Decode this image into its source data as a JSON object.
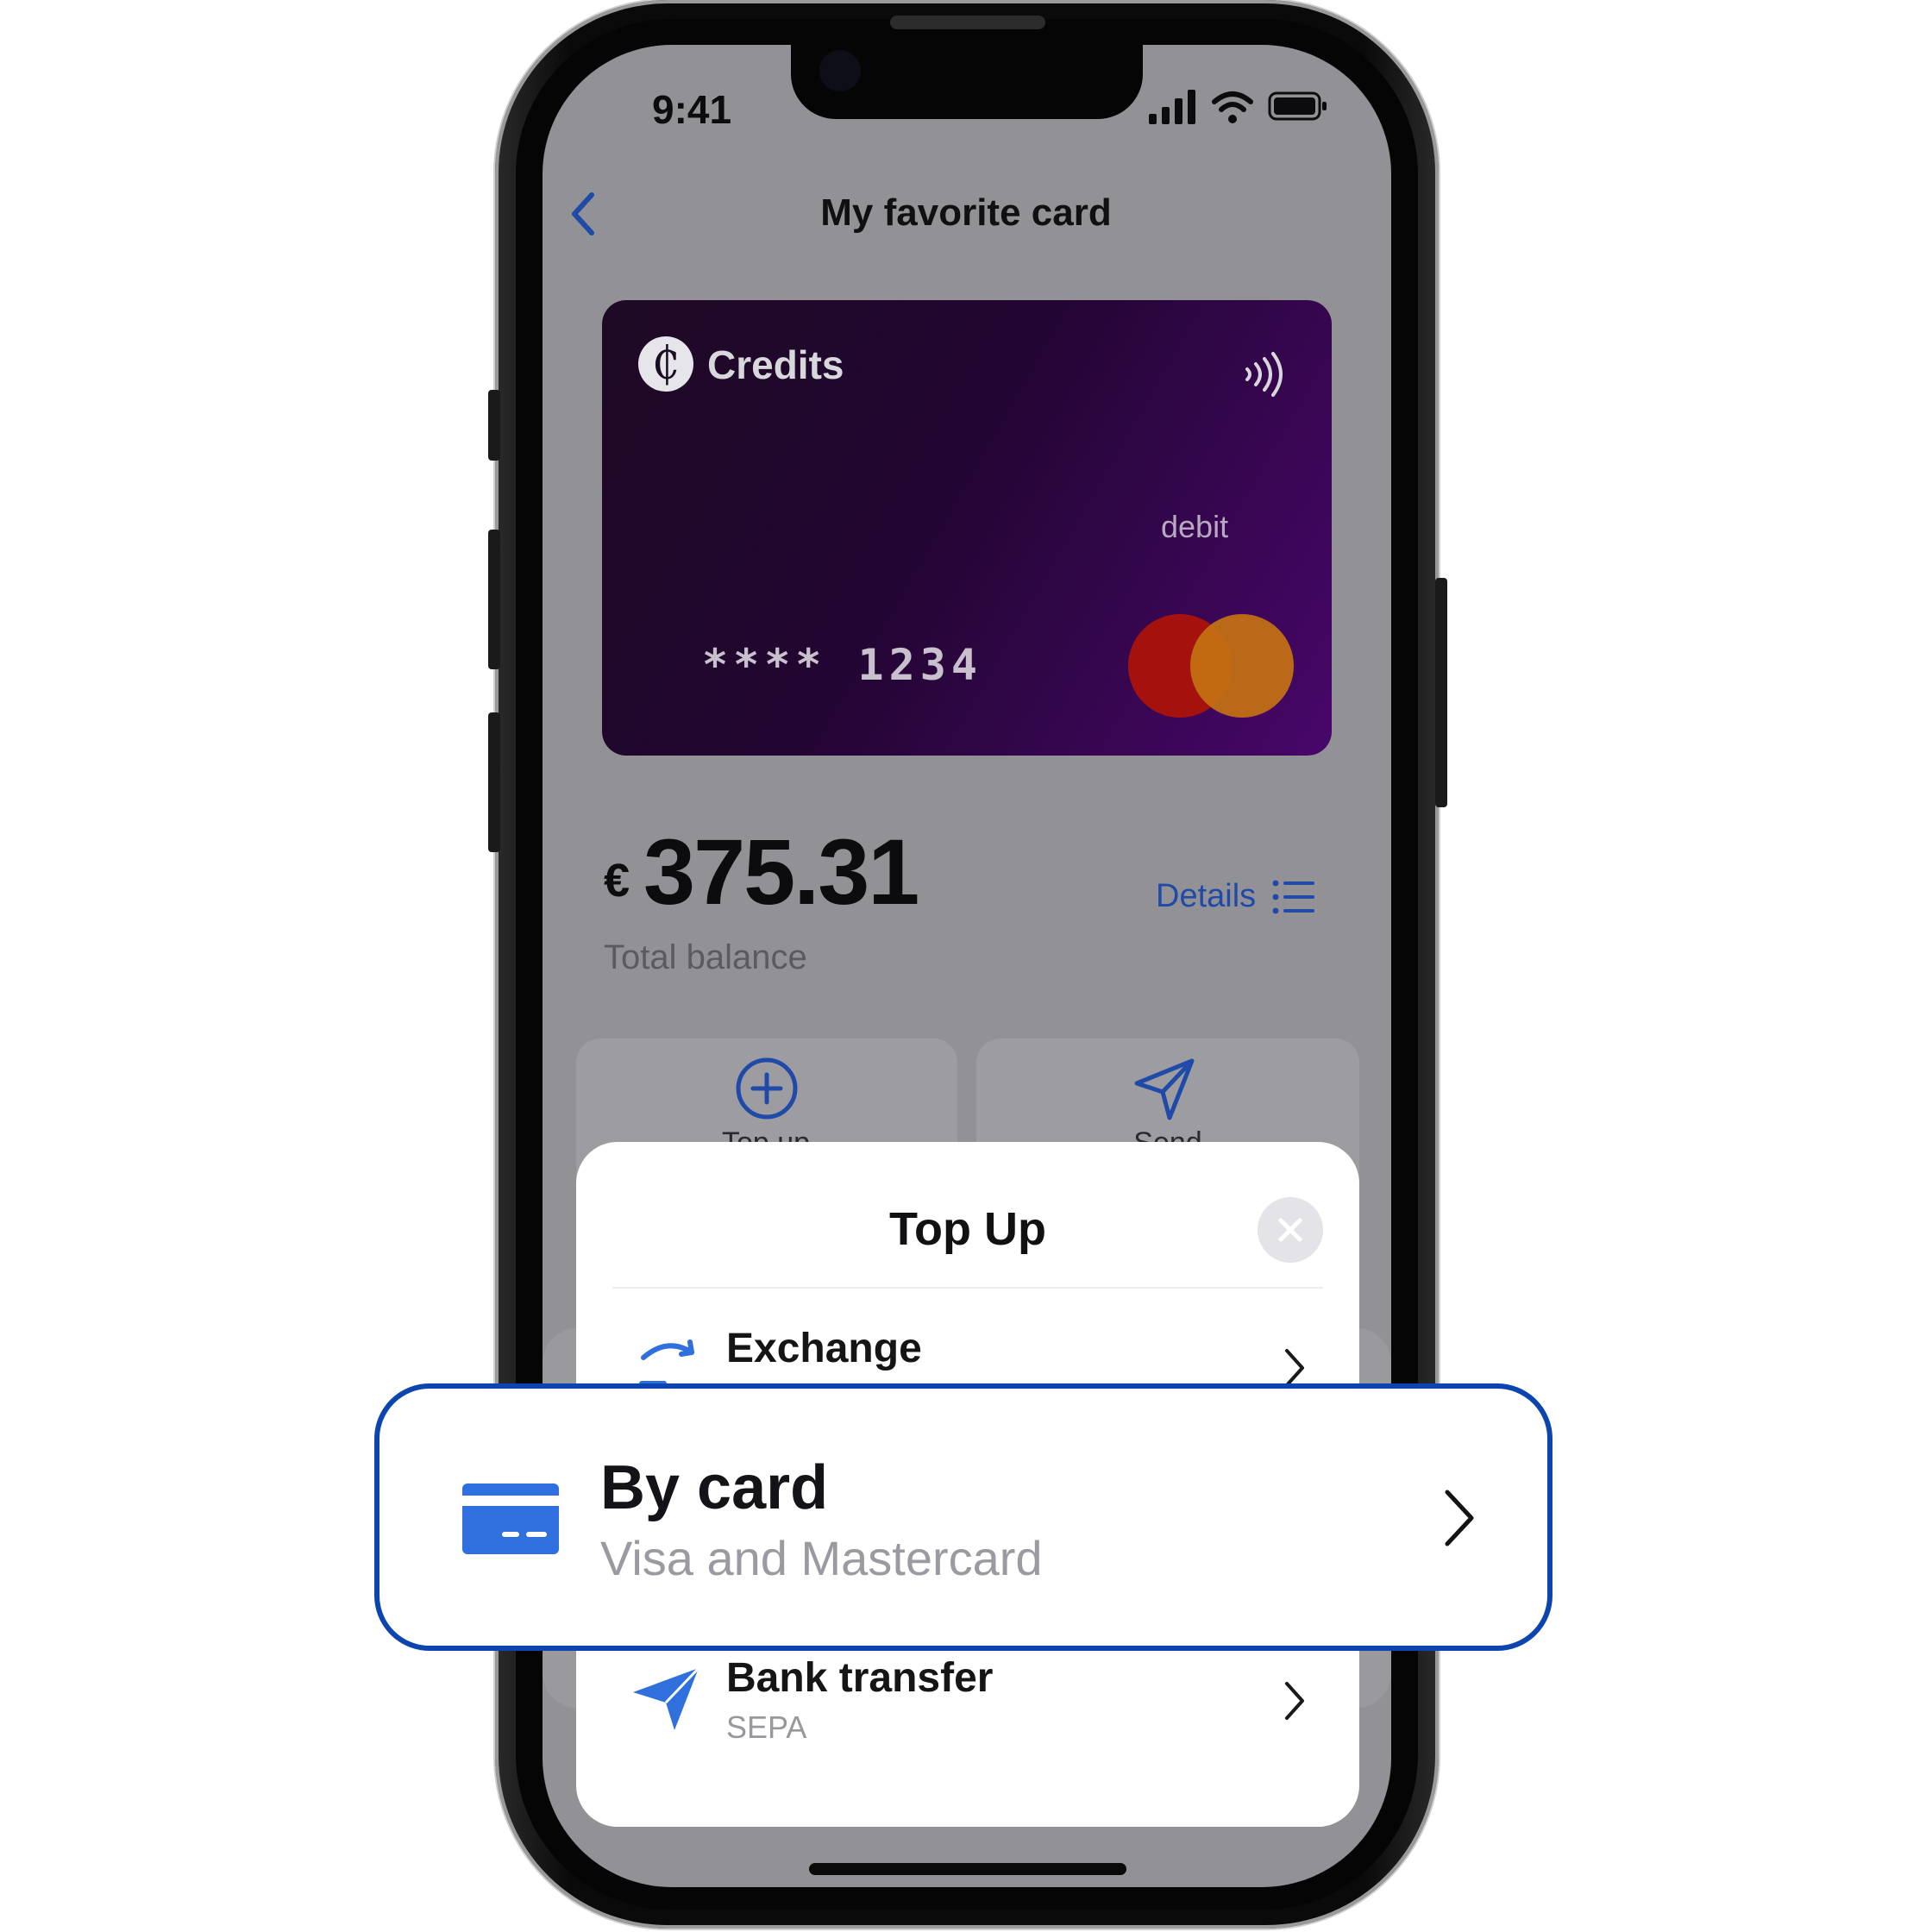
{
  "status_bar": {
    "time": "9:41"
  },
  "header": {
    "title": "My favorite card",
    "back_icon": "chevron-left-icon"
  },
  "card": {
    "brand": "Credits",
    "type": "debit",
    "number": "**** 1234",
    "network": "mastercard",
    "contactless_icon": "contactless-icon"
  },
  "balance": {
    "currency": "€",
    "amount": "375.31",
    "label": "Total balance"
  },
  "details": {
    "label": "Details"
  },
  "actions": [
    {
      "label": "Top up",
      "icon": "plus-circle-icon"
    },
    {
      "label": "Send",
      "icon": "paper-plane-icon"
    }
  ],
  "sheet": {
    "title": "Top Up",
    "options": [
      {
        "title": "Exchange",
        "icon": "exchange-icon"
      },
      {
        "title": "By card",
        "subtitle": "Visa and Mastercard",
        "icon": "credit-card-icon"
      },
      {
        "title": "Bank transfer",
        "subtitle": "SEPA",
        "icon": "paper-plane-icon"
      }
    ]
  },
  "colors": {
    "accent": "#1f4aa8",
    "highlight_border": "#0c44b0",
    "card_purple": "#48076a",
    "overlay_gray": "#929296"
  }
}
